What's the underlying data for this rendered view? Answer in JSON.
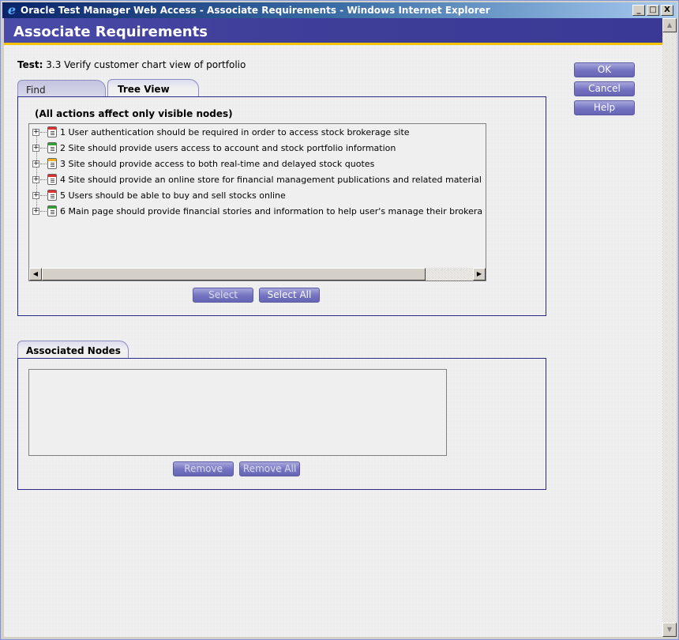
{
  "window": {
    "title": "Oracle Test Manager Web Access - Associate Requirements - Windows Internet Explorer",
    "controls": {
      "minimize": "_",
      "maximize": "□",
      "close": "X"
    }
  },
  "header": {
    "title": "Associate Requirements"
  },
  "test": {
    "label": "Test:",
    "value": "3.3 Verify customer chart view of portfolio"
  },
  "actions": {
    "ok": "OK",
    "cancel": "Cancel",
    "help": "Help"
  },
  "tabs": [
    {
      "label": "Find",
      "active": false
    },
    {
      "label": "Tree View",
      "active": true
    }
  ],
  "tree_view": {
    "note": "(All actions affect only visible nodes)",
    "nodes": [
      {
        "label": "1 User authentication should be required in order to access stock brokerage site",
        "status_color": "#e03030"
      },
      {
        "label": "2 Site should provide users access to account and stock portfolio information",
        "status_color": "#30a030"
      },
      {
        "label": "3 Site should provide access to both real-time and delayed stock quotes",
        "status_color": "#f0b020"
      },
      {
        "label": "4 Site should provide an online store for financial management publications and related material",
        "status_color": "#e03030"
      },
      {
        "label": "5 Users should be able to buy and sell stocks online",
        "status_color": "#e03030"
      },
      {
        "label": "6 Main page should provide financial stories and information to help user's manage their brokera",
        "status_color": "#30a030"
      }
    ],
    "select_label": "Select",
    "select_all_label": "Select All"
  },
  "associated": {
    "tab_label": "Associated Nodes",
    "remove_label": "Remove",
    "remove_all_label": "Remove All"
  }
}
